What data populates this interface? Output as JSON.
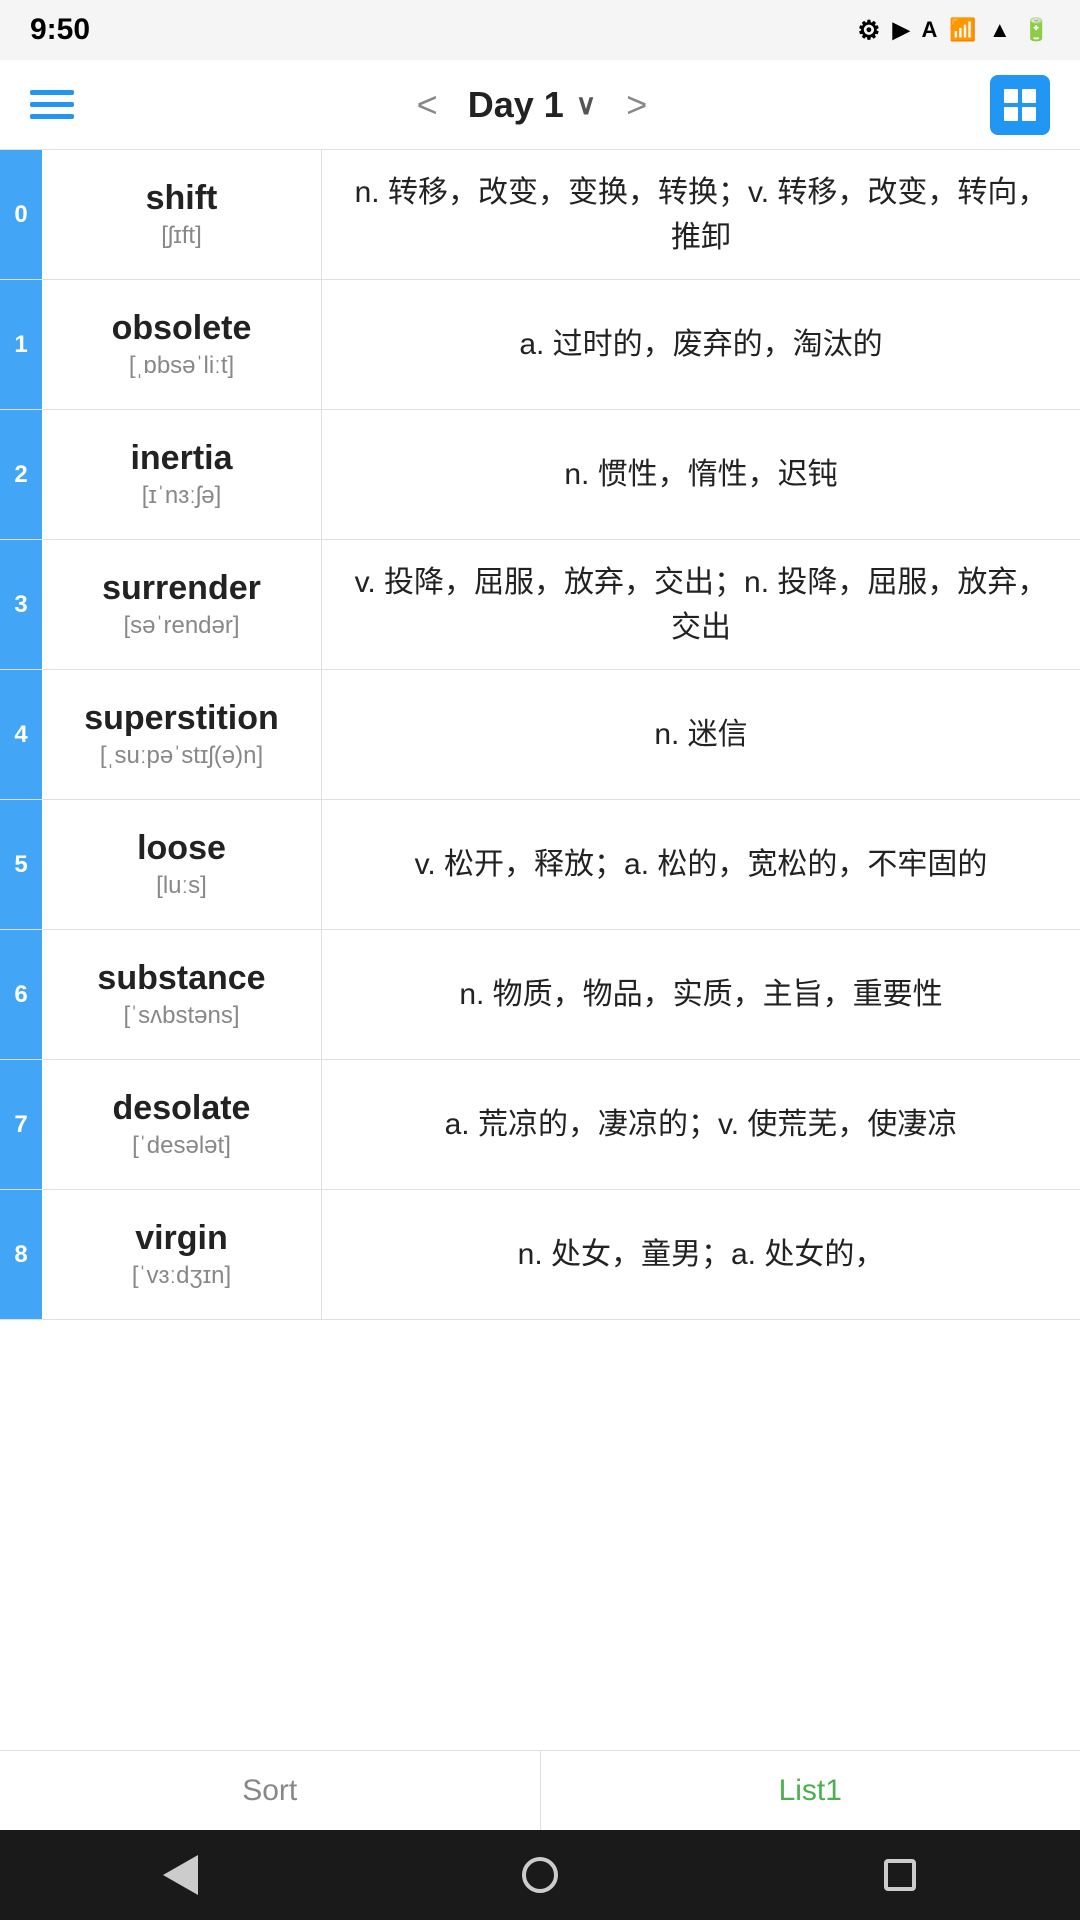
{
  "statusBar": {
    "time": "9:50",
    "icons": [
      "gear",
      "play",
      "A",
      "wifi",
      "signal",
      "battery"
    ]
  },
  "topNav": {
    "menuLabel": "menu",
    "prevLabel": "<",
    "title": "Day 1",
    "chevron": "∨",
    "nextLabel": ">",
    "gridLabel": "grid"
  },
  "words": [
    {
      "index": "0",
      "english": "shift",
      "phonetic": "[ʃɪft]",
      "definition": "n. 转移，改变，变换，转换；v. 转移，改变，转向，推卸"
    },
    {
      "index": "1",
      "english": "obsolete",
      "phonetic": "[ˌɒbsəˈliːt]",
      "definition": "a. 过时的，废弃的，淘汰的"
    },
    {
      "index": "2",
      "english": "inertia",
      "phonetic": "[ɪˈnɜːʃə]",
      "definition": "n. 惯性，惰性，迟钝"
    },
    {
      "index": "3",
      "english": "surrender",
      "phonetic": "[səˈrendər]",
      "definition": "v. 投降，屈服，放弃，交出；n. 投降，屈服，放弃，交出"
    },
    {
      "index": "4",
      "english": "superstition",
      "phonetic": "[ˌsuːpəˈstɪʃ(ə)n]",
      "definition": "n. 迷信"
    },
    {
      "index": "5",
      "english": "loose",
      "phonetic": "[luːs]",
      "definition": "v. 松开，释放；a. 松的，宽松的，不牢固的"
    },
    {
      "index": "6",
      "english": "substance",
      "phonetic": "[ˈsʌbstəns]",
      "definition": "n. 物质，物品，实质，主旨，重要性"
    },
    {
      "index": "7",
      "english": "desolate",
      "phonetic": "[ˈdesələt]",
      "definition": "a. 荒凉的，凄凉的；v. 使荒芜，使凄凉"
    },
    {
      "index": "8",
      "english": "virgin",
      "phonetic": "[ˈvɜːdʒɪn]",
      "definition": "n. 处女，童男；a. 处女的，"
    }
  ],
  "bottomTabs": {
    "sortLabel": "Sort",
    "list1Label": "List1"
  },
  "androidNav": {
    "backLabel": "back",
    "homeLabel": "home",
    "recentLabel": "recent"
  }
}
